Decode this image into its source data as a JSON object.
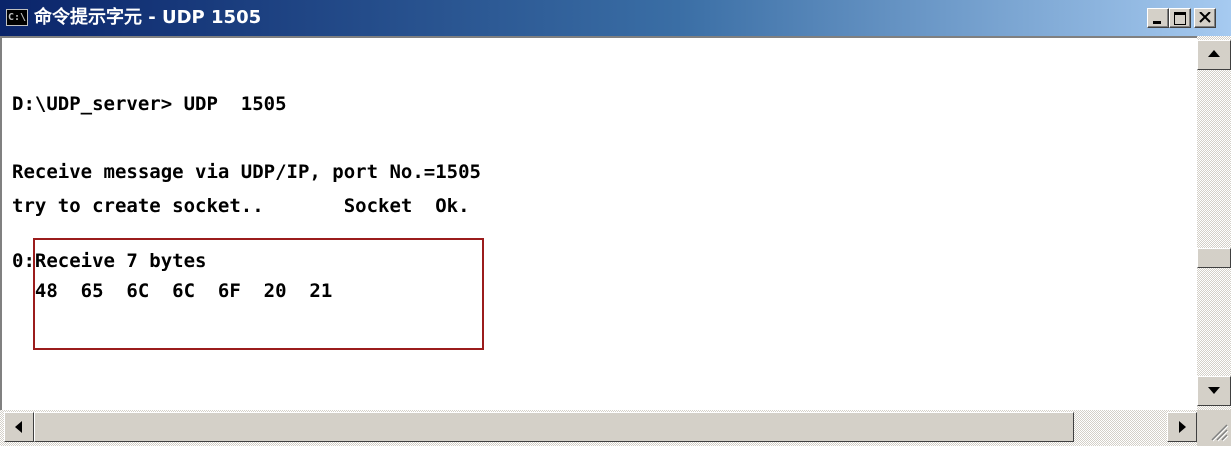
{
  "window": {
    "icon_label": "C:\\",
    "title": "命令提示字元 - UDP  1505"
  },
  "console": {
    "lines": [
      "D:\\UDP_server> UDP  1505",
      "Receive message via UDP/IP, port No.=1505",
      "try to create socket..       Socket  Ok.",
      "0:Receive 7 bytes",
      "  48  65  6C  6C  6F  20  21"
    ]
  },
  "colors": {
    "highlight_border": "#9b1c1c",
    "titlebar_start": "#0a246a",
    "titlebar_end": "#a6caf0"
  }
}
